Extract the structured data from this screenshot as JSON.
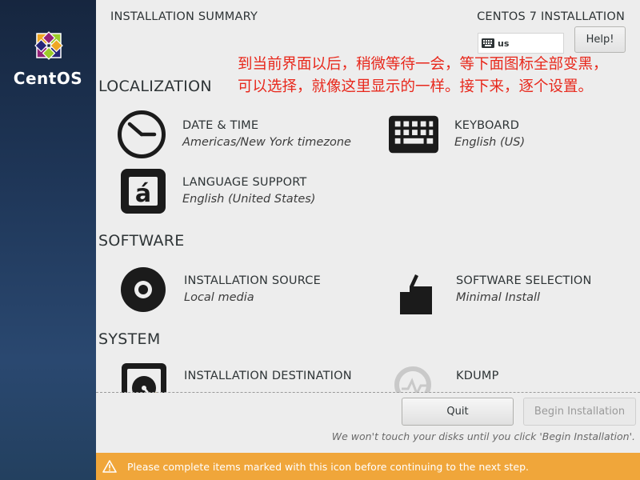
{
  "sidebar": {
    "brand": "CentOS",
    "logo_icon": "centos-logo-icon"
  },
  "header": {
    "title": "INSTALLATION SUMMARY",
    "product": "CENTOS 7 INSTALLATION",
    "keyboard_layout": "us",
    "keyboard_icon": "keyboard-icon",
    "help_label": "Help!"
  },
  "annotation": {
    "text": "到当前界面以后，稍微等待一会，等下面图标全部变黑，可以选择，就像这里显示的一样。接下来，逐个设置。",
    "color": "#e8281c"
  },
  "sections": {
    "localization": "LOCALIZATION",
    "software": "SOFTWARE",
    "system": "SYSTEM"
  },
  "spokes": {
    "date_time": {
      "title": "DATE & TIME",
      "status": "Americas/New York timezone",
      "icon": "clock-icon"
    },
    "keyboard": {
      "title": "KEYBOARD",
      "status": "English (US)",
      "icon": "keyboard-icon"
    },
    "language": {
      "title": "LANGUAGE SUPPORT",
      "status": "English (United States)",
      "icon": "language-icon"
    },
    "install_source": {
      "title": "INSTALLATION SOURCE",
      "status": "Local media",
      "icon": "disc-icon"
    },
    "software_selection": {
      "title": "SOFTWARE SELECTION",
      "status": "Minimal Install",
      "icon": "package-icon"
    },
    "install_destination": {
      "title": "INSTALLATION DESTINATION",
      "icon": "harddisk-icon"
    },
    "kdump": {
      "title": "KDUMP",
      "icon": "kdump-icon"
    }
  },
  "footer": {
    "quit_label": "Quit",
    "begin_label": "Begin Installation",
    "note": "We won't touch your disks until you click 'Begin Installation'.",
    "warning_text": "Please complete items marked with this icon before continuing to the next step.",
    "warning_icon": "warning-icon",
    "warning_color": "#f0a63a"
  }
}
